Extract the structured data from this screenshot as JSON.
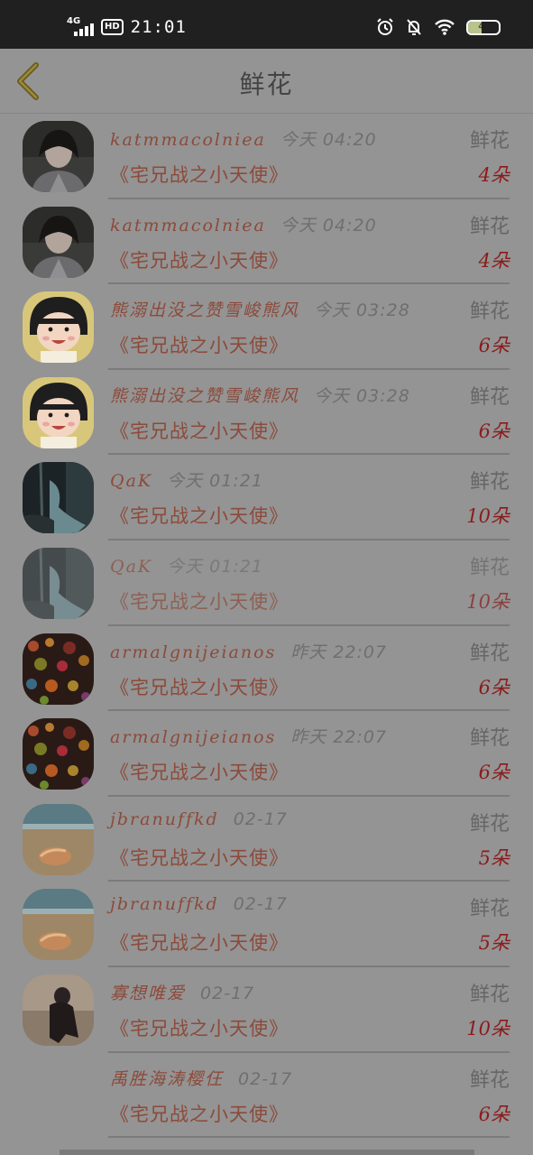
{
  "status_bar": {
    "network": "4G",
    "hd": "HD",
    "time": "21:01",
    "battery": "45",
    "battery_level": 0.45
  },
  "header": {
    "title": "鲜花",
    "back_icon": "chevron-left-icon"
  },
  "list": {
    "items": [
      {
        "name": "katmmacolniea",
        "time": "今天 04:20",
        "kind": "鲜花",
        "book": "《宅兄战之小天使》",
        "count": "4朵",
        "avatar": "photo-girl",
        "faded": false
      },
      {
        "name": "katmmacolniea",
        "time": "今天 04:20",
        "kind": "鲜花",
        "book": "《宅兄战之小天使》",
        "count": "4朵",
        "avatar": "photo-girl",
        "faded": false
      },
      {
        "name": "熊溺出没之赞雪峻熊风",
        "time": "今天 03:28",
        "kind": "鲜花",
        "book": "《宅兄战之小天使》",
        "count": "6朵",
        "avatar": "cartoon-girl",
        "faded": false
      },
      {
        "name": "熊溺出没之赞雪峻熊风",
        "time": "今天 03:28",
        "kind": "鲜花",
        "book": "《宅兄战之小天使》",
        "count": "6朵",
        "avatar": "cartoon-girl",
        "faded": false
      },
      {
        "name": "QaK",
        "time": "今天 01:21",
        "kind": "鲜花",
        "book": "《宅兄战之小天使》",
        "count": "10朵",
        "avatar": "dark-scene",
        "faded": false
      },
      {
        "name": "QaK",
        "time": "今天 01:21",
        "kind": "鲜花",
        "book": "《宅兄战之小天使》",
        "count": "10朵",
        "avatar": "dark-scene",
        "faded": true
      },
      {
        "name": "armalgnijeianos",
        "time": "昨天 22:07",
        "kind": "鲜花",
        "book": "《宅兄战之小天使》",
        "count": "6朵",
        "avatar": "bokeh",
        "faded": false
      },
      {
        "name": "armalgnijeianos",
        "time": "昨天 22:07",
        "kind": "鲜花",
        "book": "《宅兄战之小天使》",
        "count": "6朵",
        "avatar": "bokeh",
        "faded": false
      },
      {
        "name": "jbranuffkd",
        "time": "02-17",
        "kind": "鲜花",
        "book": "《宅兄战之小天使》",
        "count": "5朵",
        "avatar": "beach-shell",
        "faded": false
      },
      {
        "name": "jbranuffkd",
        "time": "02-17",
        "kind": "鲜花",
        "book": "《宅兄战之小天使》",
        "count": "5朵",
        "avatar": "beach-shell",
        "faded": false
      },
      {
        "name": "寡想唯爱",
        "time": "02-17",
        "kind": "鲜花",
        "book": "《宅兄战之小天使》",
        "count": "10朵",
        "avatar": "dark-figure",
        "faded": false
      },
      {
        "name": "禹胜海涛樱仼",
        "time": "02-17",
        "kind": "鲜花",
        "book": "《宅兄战之小天使》",
        "count": "6朵",
        "avatar": "none",
        "faded": false
      }
    ]
  },
  "colors": {
    "overlay_bg": "#949494",
    "name": "#8c4a3a",
    "count": "#8b1b1b",
    "status_bar": "#202020"
  }
}
